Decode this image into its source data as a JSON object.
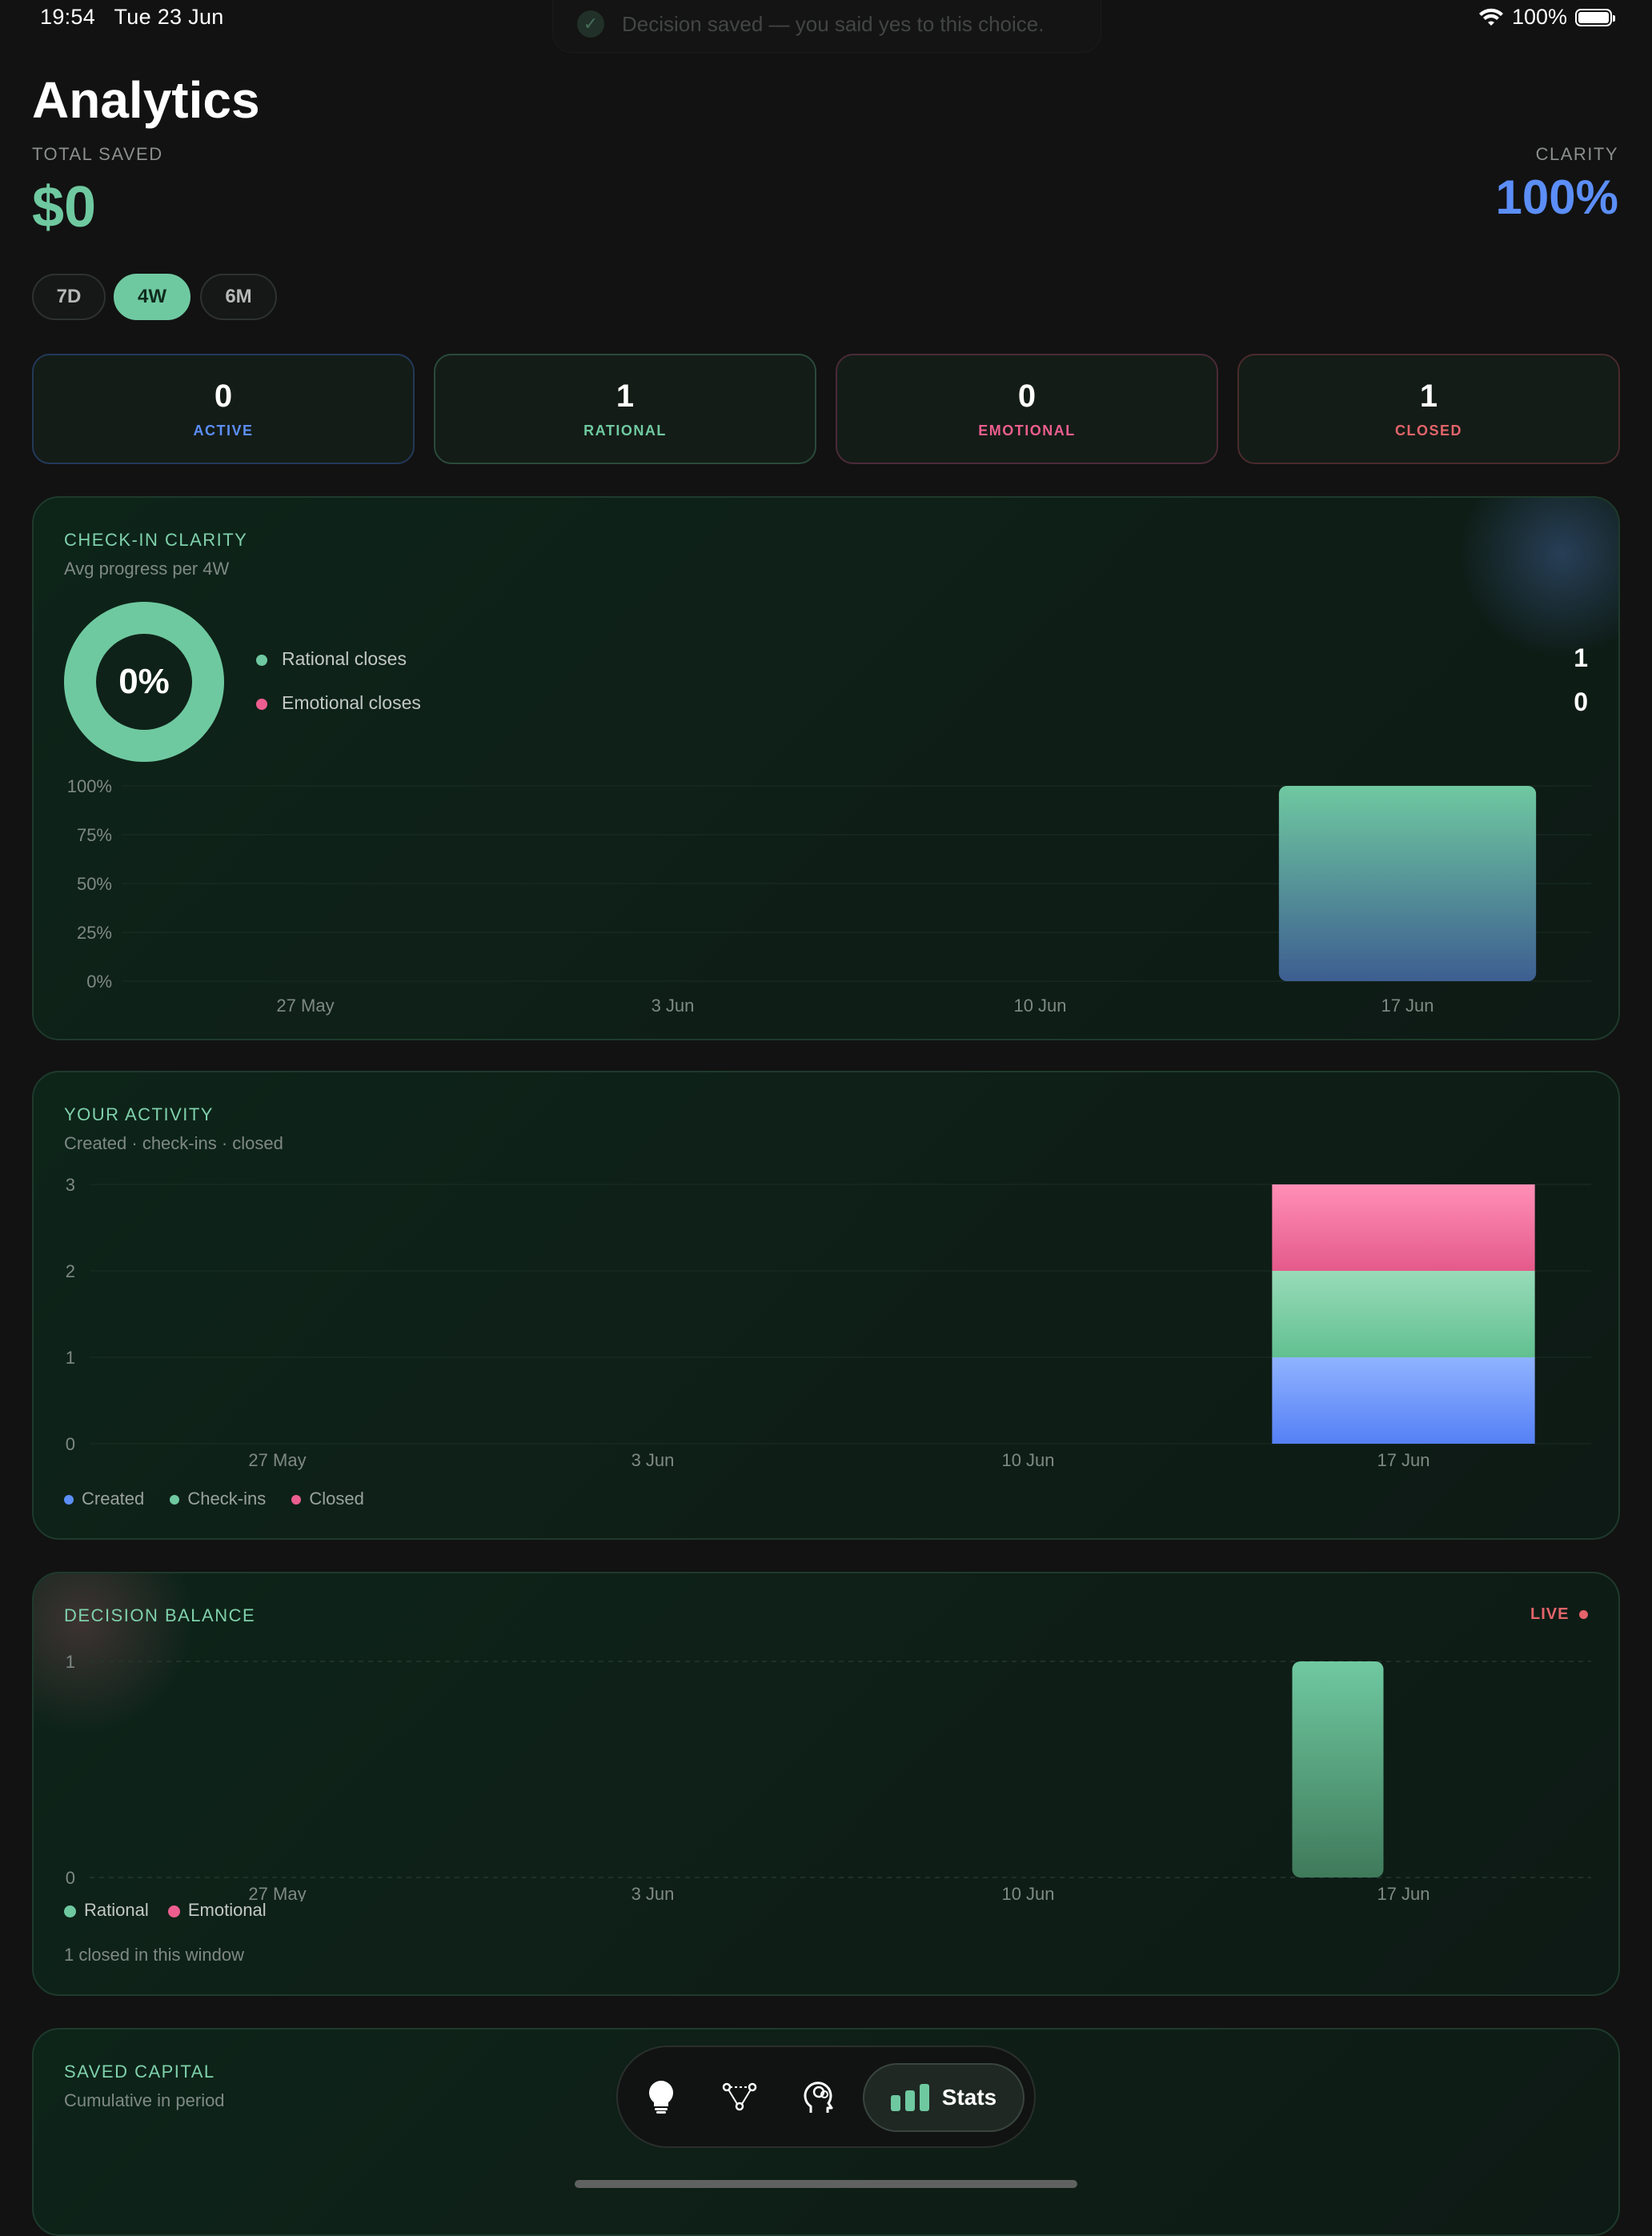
{
  "status": {
    "time": "19:54",
    "date": "Tue 23 Jun",
    "battery": "100%"
  },
  "toast": {
    "text": "Decision saved — you said yes to this choice."
  },
  "header": {
    "title": "Analytics",
    "total_saved_label": "TOTAL SAVED",
    "total_saved_value": "$0",
    "clarity_label": "CLARITY",
    "clarity_value": "100%"
  },
  "ranges": [
    {
      "label": "7D",
      "active": false
    },
    {
      "label": "4W",
      "active": true
    },
    {
      "label": "6M",
      "active": false
    }
  ],
  "stats": [
    {
      "value": "0",
      "label": "ACTIVE",
      "color": "#5b8ef7"
    },
    {
      "value": "1",
      "label": "RATIONAL",
      "color": "#6fc9a0"
    },
    {
      "value": "0",
      "label": "EMOTIONAL",
      "color": "#ec5e8f"
    },
    {
      "value": "1",
      "label": "CLOSED",
      "color": "#e3646a"
    }
  ],
  "checkin": {
    "title": "CHECK-IN CLARITY",
    "subtitle": "Avg progress per 4W",
    "donut_value": "0%",
    "legend": [
      {
        "label": "Rational closes",
        "value": "1",
        "color": "#6fc9a0"
      },
      {
        "label": "Emotional closes",
        "value": "0",
        "color": "#ec5e8f"
      }
    ]
  },
  "activity": {
    "title": "YOUR ACTIVITY",
    "subtitle": "Created · check-ins · closed",
    "legend": [
      {
        "label": "Created",
        "color": "#5b8ef7"
      },
      {
        "label": "Check-ins",
        "color": "#6fc9a0"
      },
      {
        "label": "Closed",
        "color": "#ec5e8f"
      }
    ]
  },
  "balance": {
    "title": "DECISION BALANCE",
    "live": "LIVE",
    "legend": [
      {
        "label": "Rational",
        "color": "#6fc9a0"
      },
      {
        "label": "Emotional",
        "color": "#ec5e8f"
      }
    ],
    "footer": "1 closed in this window"
  },
  "capital": {
    "title": "SAVED CAPITAL",
    "subtitle": "Cumulative in period"
  },
  "tabbar": {
    "items": [
      {
        "icon": "lightbulb-icon"
      },
      {
        "icon": "network-icon"
      },
      {
        "icon": "brain-head-icon"
      },
      {
        "icon": "bar-chart-icon",
        "label": "Stats",
        "active": true
      }
    ]
  },
  "chart_data": [
    {
      "type": "bar",
      "title": "CHECK-IN CLARITY",
      "categories": [
        "27 May",
        "3 Jun",
        "10 Jun",
        "17 Jun"
      ],
      "y_ticks": [
        "100%",
        "75%",
        "50%",
        "25%",
        "0%"
      ],
      "ylim": [
        0,
        100
      ],
      "values": [
        0,
        0,
        0,
        100
      ]
    },
    {
      "type": "bar",
      "title": "YOUR ACTIVITY",
      "categories": [
        "27 May",
        "3 Jun",
        "10 Jun",
        "17 Jun"
      ],
      "y_ticks": [
        "3",
        "2",
        "1",
        "0"
      ],
      "ylim": [
        0,
        3
      ],
      "series": [
        {
          "name": "Created",
          "values": [
            0,
            0,
            0,
            1
          ]
        },
        {
          "name": "Check-ins",
          "values": [
            0,
            0,
            0,
            1
          ]
        },
        {
          "name": "Closed",
          "values": [
            0,
            0,
            0,
            1
          ]
        }
      ]
    },
    {
      "type": "bar",
      "title": "DECISION BALANCE",
      "categories": [
        "27 May",
        "3 Jun",
        "10 Jun",
        "17 Jun"
      ],
      "y_ticks": [
        "1",
        "0"
      ],
      "ylim": [
        0,
        1
      ],
      "series": [
        {
          "name": "Rational",
          "values": [
            0,
            0,
            0,
            1
          ]
        },
        {
          "name": "Emotional",
          "values": [
            0,
            0,
            0,
            0
          ]
        }
      ]
    }
  ]
}
